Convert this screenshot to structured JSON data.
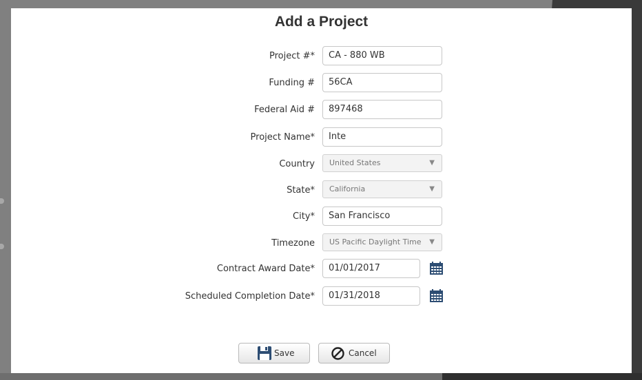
{
  "form": {
    "title": "Add a Project",
    "fields": [
      {
        "label": "Project #*",
        "value": "CA - 880 WB"
      },
      {
        "label": "Funding #",
        "value": "56CA"
      },
      {
        "label": "Federal Aid #",
        "value": "897468"
      },
      {
        "label": "Project Name*",
        "value": "Inte"
      },
      {
        "label": "Country",
        "value": "United States"
      },
      {
        "label": "State*",
        "value": "California"
      },
      {
        "label": "City*",
        "value": "San Francisco"
      },
      {
        "label": "Timezone",
        "value": "US Pacific Daylight Time"
      },
      {
        "label": "Contract Award Date*",
        "value": "01/01/2017"
      },
      {
        "label": "Scheduled Completion Date*",
        "value": "01/31/2018"
      }
    ],
    "save_label": "Save",
    "cancel_label": "Cancel"
  },
  "icons": {
    "select_caret": "caret-down-icon",
    "date_picker": "calendar-icon",
    "save": "floppy-disk-icon",
    "cancel": "no-entry-icon"
  },
  "colors": {
    "calendar": "#2d4d73",
    "cancel_icon": "#222222"
  }
}
